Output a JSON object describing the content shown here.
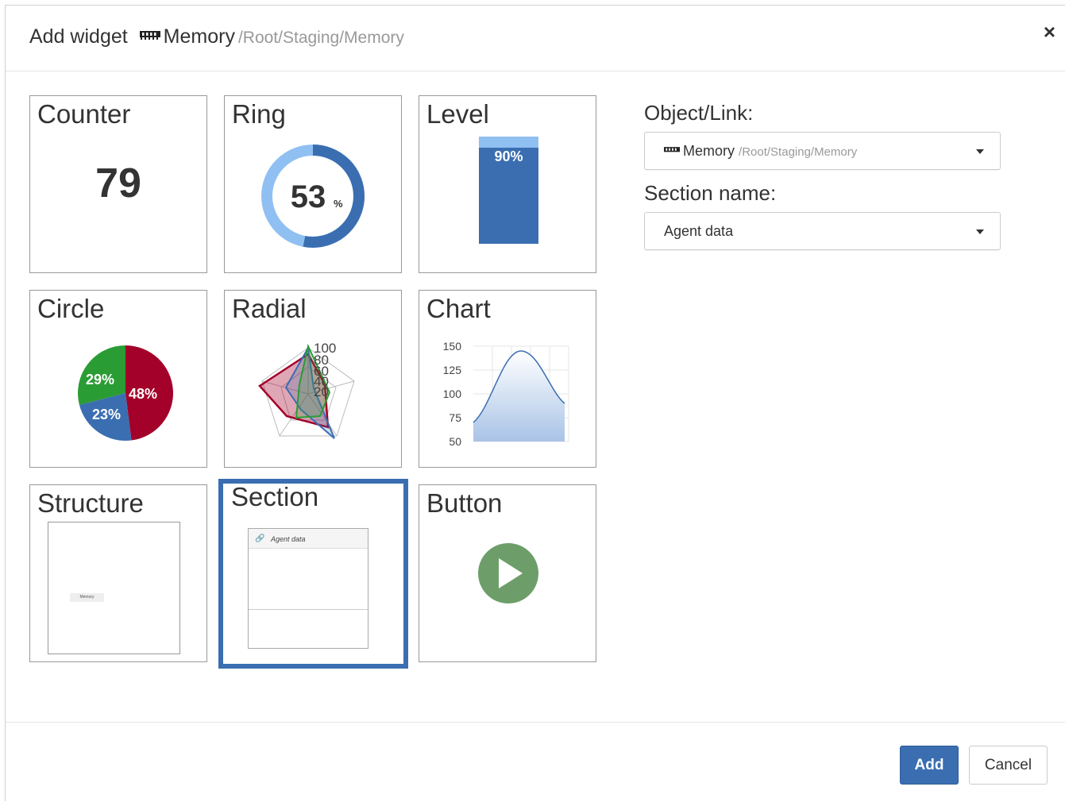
{
  "header": {
    "title": "Add widget",
    "object_icon": "memory-icon",
    "object_name": "Memory",
    "object_path": "/Root/Staging/Memory",
    "close_label": "×"
  },
  "tiles": [
    {
      "name": "Counter",
      "value": "79"
    },
    {
      "name": "Ring",
      "value": "53",
      "unit": "%",
      "percent": 53
    },
    {
      "name": "Level",
      "value": "90%",
      "percent": 90
    },
    {
      "name": "Circle",
      "slices": [
        {
          "label": "48%",
          "value": 48,
          "color": "#a3002a"
        },
        {
          "label": "23%",
          "value": 23,
          "color": "#3a6eb1"
        },
        {
          "label": "29%",
          "value": 29,
          "color": "#2a9c34"
        }
      ]
    },
    {
      "name": "Radial",
      "tick_labels": [
        "100",
        "80",
        "60",
        "40",
        "20"
      ]
    },
    {
      "name": "Chart",
      "y_ticks": [
        "150",
        "125",
        "100",
        "75",
        "50"
      ]
    },
    {
      "name": "Structure",
      "inner_label": "Memory"
    },
    {
      "name": "Section",
      "inner_label": "Agent data",
      "selected": true
    },
    {
      "name": "Button",
      "icon": "play-icon"
    }
  ],
  "form": {
    "object_label": "Object/Link:",
    "object_value": "Memory",
    "object_path": "/Root/Staging/Memory",
    "section_label": "Section name:",
    "section_value": "Agent data"
  },
  "footer": {
    "add_label": "Add",
    "cancel_label": "Cancel"
  },
  "colors": {
    "accent": "#3a6eb1",
    "ring_light": "#90c0f2",
    "pie_red": "#a3002a",
    "pie_blue": "#3a6eb1",
    "pie_green": "#2a9c34",
    "play_green": "#6d9e6a"
  }
}
